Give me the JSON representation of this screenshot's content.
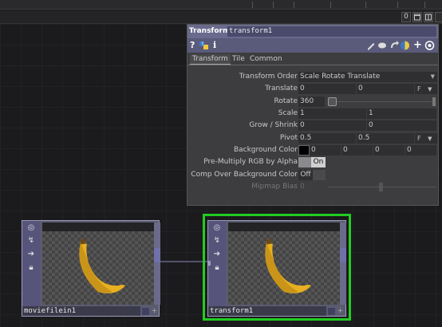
{
  "toolbar": {
    "counter": "0"
  },
  "panel": {
    "op_type": "Transform",
    "op_name": "transform1",
    "icons": [
      "help-icon",
      "python-help-icon",
      "info-icon",
      "edit-icon",
      "comment-icon",
      "clone-icon",
      "python-icon",
      "add-icon",
      "viewer-icon"
    ],
    "tabs": [
      "Transform",
      "Tile",
      "Common"
    ],
    "params": {
      "transform_order": {
        "label": "Transform Order",
        "value": "Scale Rotate Translate"
      },
      "translate": {
        "label": "Translate",
        "x": "0",
        "y": "0",
        "unit": "F"
      },
      "rotate": {
        "label": "Rotate",
        "value": "360"
      },
      "scale": {
        "label": "Scale",
        "x": "1",
        "y": "1"
      },
      "grow_shrink": {
        "label": "Grow / Shrink",
        "x": "0",
        "y": "0"
      },
      "pivot": {
        "label": "Pivot",
        "x": "0.5",
        "y": "0.5",
        "unit": "F"
      },
      "bg_color": {
        "label": "Background Color",
        "swatch": "#000000",
        "r": "0",
        "g": "0",
        "b": "0",
        "a": "0"
      },
      "premultiply": {
        "label": "Pre-Multiply RGB by Alpha",
        "value": "On"
      },
      "comp_over": {
        "label": "Comp Over Background Color",
        "value": "Off"
      },
      "mipmap": {
        "label": "Mipmap Bias",
        "value": "0"
      }
    }
  },
  "nodes": {
    "moviefilein": {
      "name": "moviefilein1"
    },
    "transform": {
      "name": "transform1"
    }
  },
  "colors": {
    "selected_border": "#22cc22",
    "op_header": "#6a6a8e",
    "wire": "#8888bb"
  }
}
